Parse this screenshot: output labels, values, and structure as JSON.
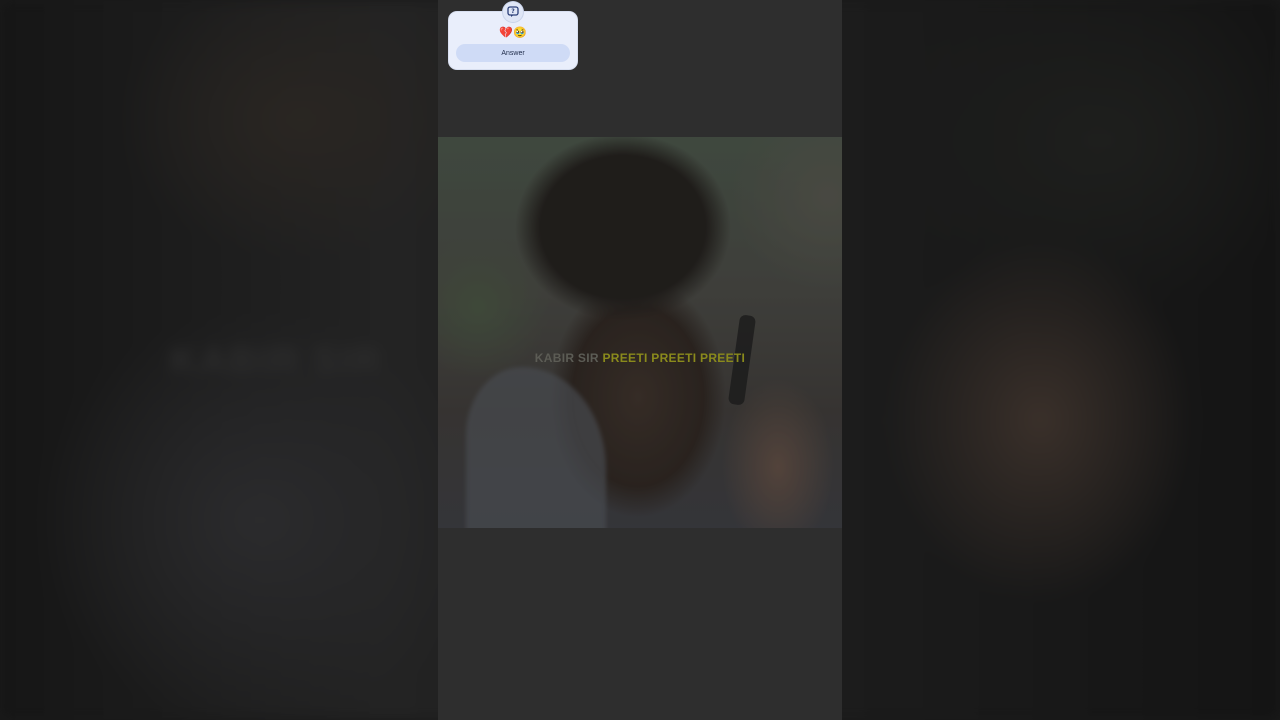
{
  "qa_card": {
    "badge_icon": "question-bubble-icon",
    "emoji_text": "💔🥹",
    "answer_label": "Answer",
    "accent_color": "#cfdbf6"
  },
  "video": {
    "caption_lead": "KABIR SIR",
    "caption_highlight": "PREETI PREETI PREETI",
    "highlight_color": "#8a8a1c"
  }
}
